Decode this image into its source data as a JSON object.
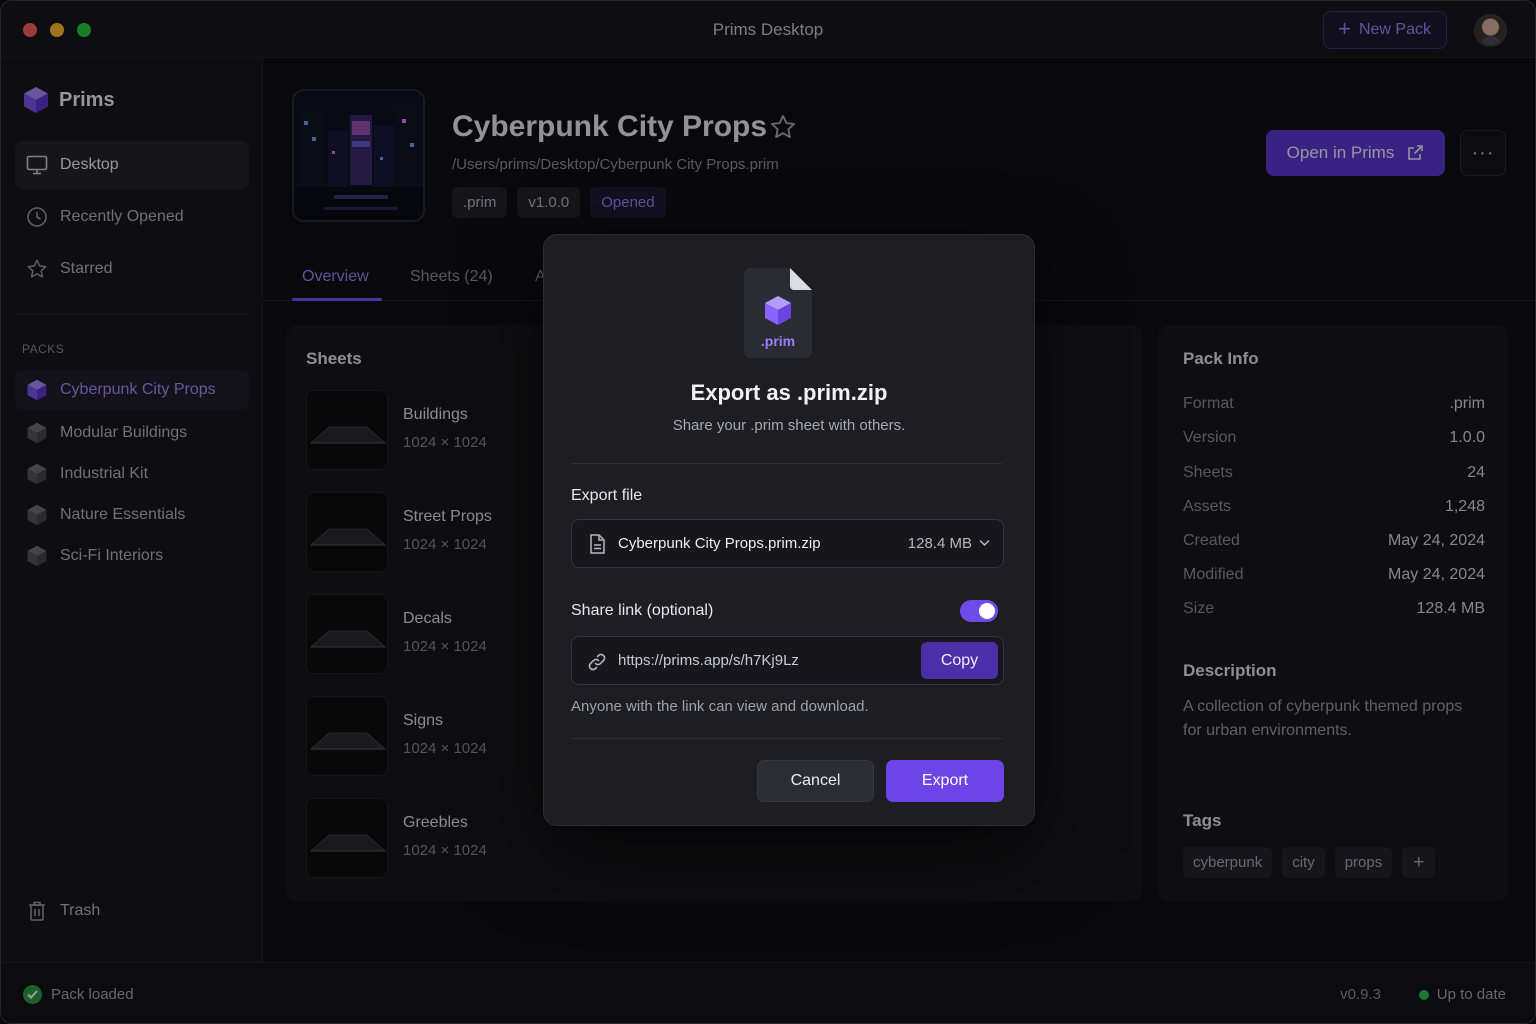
{
  "window": {
    "title": "Prims Desktop"
  },
  "header": {
    "new_pack_label": "New Pack"
  },
  "sidebar": {
    "brand": "Prims",
    "nav": [
      {
        "label": "Desktop",
        "icon": "monitor-icon",
        "active": true
      },
      {
        "label": "Recently Opened",
        "icon": "clock-icon"
      },
      {
        "label": "Starred",
        "icon": "star-icon"
      }
    ],
    "packs_label": "PACKS",
    "packs": [
      {
        "label": "Cyberpunk City Props",
        "active": true
      },
      {
        "label": "Modular Buildings"
      },
      {
        "label": "Industrial Kit"
      },
      {
        "label": "Nature Essentials"
      },
      {
        "label": "Sci-Fi Interiors"
      }
    ],
    "trash_label": "Trash"
  },
  "pack": {
    "title": "Cyberpunk City Props",
    "path": "/Users/prims/Desktop/Cyberpunk City Props.prim",
    "chips": [
      ".prim",
      "v1.0.0",
      "Opened"
    ],
    "open_label": "Open in Prims",
    "more_label": "···"
  },
  "tabs": [
    {
      "label": "Overview",
      "active": true
    },
    {
      "label": "Sheets (24)"
    },
    {
      "label": "A"
    }
  ],
  "sheets": {
    "title": "Sheets",
    "items": [
      {
        "name": "Buildings",
        "dims": "1024 × 1024"
      },
      {
        "name": "Street Props",
        "dims": "1024 × 1024"
      },
      {
        "name": "Decals",
        "dims": "1024 × 1024"
      },
      {
        "name": "Signs",
        "dims": "1024 × 1024"
      },
      {
        "name": "Greebles",
        "dims": "1024 × 1024"
      }
    ]
  },
  "pack_info": {
    "title": "Pack Info",
    "rows": [
      {
        "k": "Format",
        "v": ".prim"
      },
      {
        "k": "Version",
        "v": "1.0.0"
      },
      {
        "k": "Sheets",
        "v": "24"
      },
      {
        "k": "Assets",
        "v": "1,248"
      },
      {
        "k": "Created",
        "v": "May 24, 2024"
      },
      {
        "k": "Modified",
        "v": "May 24, 2024"
      },
      {
        "k": "Size",
        "v": "128.4 MB"
      }
    ],
    "description_title": "Description",
    "description": "A collection of cyberpunk themed props for urban environments.",
    "tags_title": "Tags",
    "tags": [
      "cyberpunk",
      "city",
      "props"
    ],
    "add_tag": "+"
  },
  "modal": {
    "file_badge": ".prim",
    "title": "Export as .prim.zip",
    "subtitle": "Share your .prim sheet with others.",
    "export_file_label": "Export file",
    "file_name": "Cyberpunk City Props.prim.zip",
    "file_size": "128.4 MB",
    "share_label": "Share link (optional)",
    "share_enabled": true,
    "share_url": "https://prims.app/s/h7Kj9Lz",
    "copy_label": "Copy",
    "note": "Anyone with the link can view and download.",
    "cancel_label": "Cancel",
    "export_label": "Export"
  },
  "status": {
    "left": "Pack loaded",
    "version": "v0.9.3",
    "right": "Up to date"
  },
  "colors": {
    "accent": "#6d44ea",
    "accent_text": "#9b83ff",
    "success": "#2cbf55"
  }
}
